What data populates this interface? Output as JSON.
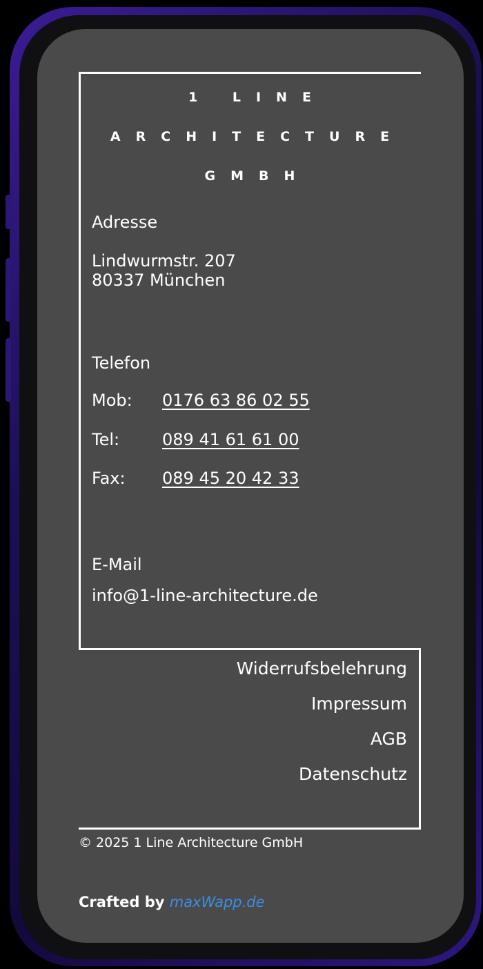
{
  "company": {
    "logo_line1": "1 LINE",
    "logo_line2": "ARCHITECTURE",
    "logo_line3": "GMBH"
  },
  "address": {
    "heading": "Adresse",
    "street": "Lindwurmstr. 207",
    "city": "80337 München"
  },
  "phone": {
    "heading": "Telefon",
    "rows": [
      {
        "label": "Mob:",
        "number": "0176 63 86 02 55"
      },
      {
        "label": "Tel:",
        "number": "089 41 61 61 00"
      },
      {
        "label": "Fax:",
        "number": "089 45 20 42 33"
      }
    ]
  },
  "email": {
    "heading": "E-Mail",
    "address": "info@1-line-architecture.de"
  },
  "legal_links": [
    "Widerrufsbelehrung",
    "Impressum",
    "AGB",
    "Datenschutz"
  ],
  "footer": {
    "copyright": "© 2025 1 Line Architecture GmbH",
    "crafted_prefix": "Crafted by ",
    "crafted_brand": "maxWapp.de"
  },
  "colors": {
    "screen_bg": "#4a4a4a",
    "text": "#ffffff",
    "brand_link": "#3a8ee6",
    "phone_frame": "#2a1776"
  }
}
